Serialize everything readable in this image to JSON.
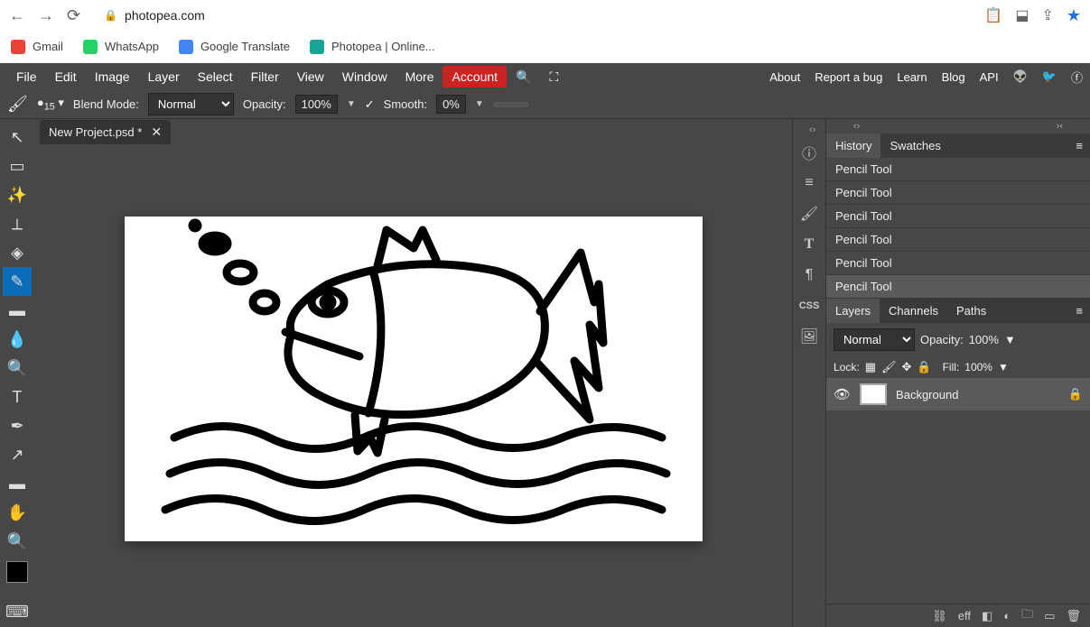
{
  "browser": {
    "url": "photopea.com",
    "bookmarks": [
      "Gmail",
      "WhatsApp",
      "Google Translate",
      "Photopea | Online..."
    ]
  },
  "menu": {
    "items": [
      "File",
      "Edit",
      "Image",
      "Layer",
      "Select",
      "Filter",
      "View",
      "Window",
      "More"
    ],
    "account": "Account",
    "right": [
      "About",
      "Report a bug",
      "Learn",
      "Blog",
      "API"
    ]
  },
  "options": {
    "blend_label": "Blend Mode:",
    "blend_value": "Normal",
    "opacity_label": "Opacity:",
    "opacity_value": "100%",
    "smooth_label": "Smooth:",
    "smooth_value": "0%",
    "brush_size": "15"
  },
  "document": {
    "tab_name": "New Project.psd *"
  },
  "history": {
    "tabs": [
      "History",
      "Swatches"
    ],
    "items": [
      "Pencil Tool",
      "Pencil Tool",
      "Pencil Tool",
      "Pencil Tool",
      "Pencil Tool",
      "Pencil Tool"
    ]
  },
  "layers": {
    "tabs": [
      "Layers",
      "Channels",
      "Paths"
    ],
    "blend": "Normal",
    "opacity_label": "Opacity:",
    "opacity_value": "100%",
    "lock_label": "Lock:",
    "fill_label": "Fill:",
    "fill_value": "100%",
    "items": [
      {
        "name": "Background"
      }
    ]
  },
  "css_label": "CSS",
  "footer_icons": {
    "link": "⛓",
    "fx": "eff",
    "mask": "◧",
    "adjust": "◐",
    "folder": "🗀",
    "new": "▭",
    "trash": "🗑"
  }
}
